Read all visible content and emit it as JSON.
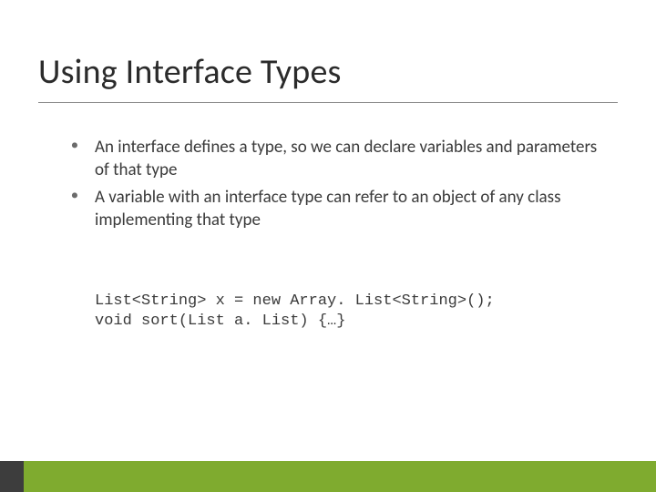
{
  "title": "Using Interface Types",
  "bullets": [
    "An interface defines a type, so we can declare variables and parameters of that type",
    "A variable with an interface type can refer to an object of any class implementing that type"
  ],
  "code": {
    "line1": "List<String> x = new Array. List<String>();",
    "line2": "void sort(List a. List) {…}"
  },
  "colors": {
    "footer_dark": "#3d3d3d",
    "footer_green": "#7fab2f"
  }
}
